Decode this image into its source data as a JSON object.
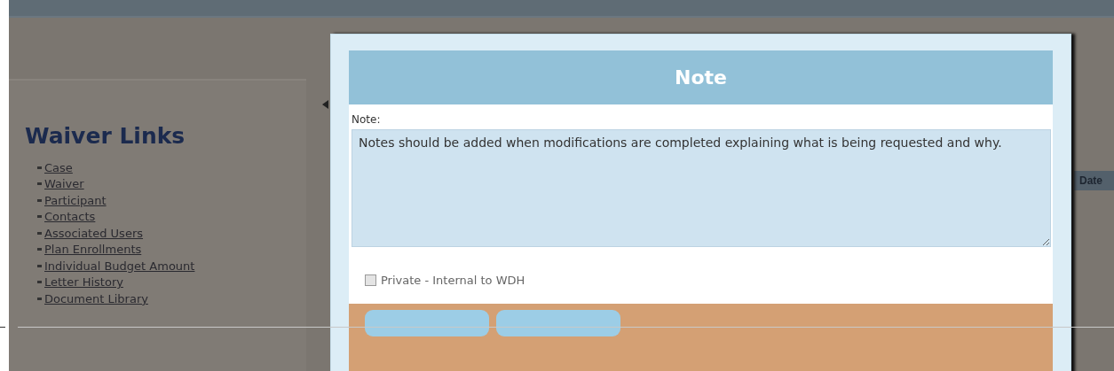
{
  "sidebar": {
    "title": "Waiver Links",
    "links": [
      "Case",
      "Waiver",
      "Participant",
      "Contacts",
      "Associated Users",
      "Plan Enrollments",
      "Individual Budget Amount",
      "Letter History",
      "Document Library"
    ]
  },
  "background_table": {
    "column_header": "Date"
  },
  "dialog": {
    "title": "Note",
    "field_label": "Note:",
    "note_value": "Notes should be added when modifications are completed explaining what is being requested and why.",
    "private": {
      "label": "Private - Internal to WDH",
      "checked": false
    },
    "buttons": [
      {
        "kind": "button"
      },
      {
        "kind": "button"
      }
    ]
  }
}
